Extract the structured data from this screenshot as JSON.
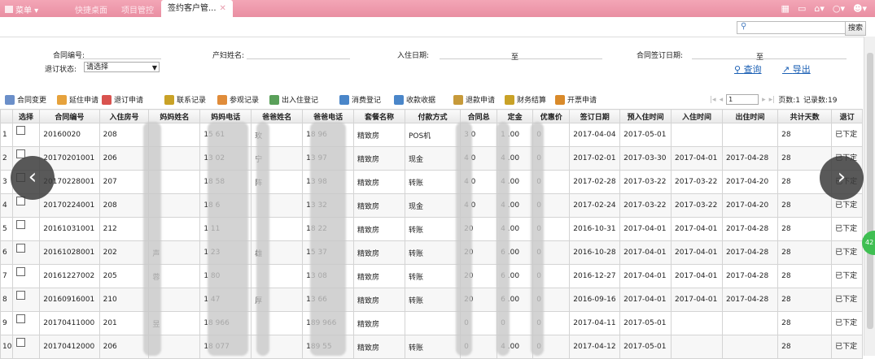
{
  "topbar": {
    "menu_label": "菜单 ▾",
    "tabs": [
      "快捷桌面",
      "项目管控"
    ],
    "active_tab": "签约客户管...",
    "active_close": "✕",
    "icons": [
      "grid-icon",
      "monitor-icon",
      "home-icon",
      "bulb-icon",
      "user-icon"
    ]
  },
  "search": {
    "placeholder": "",
    "button_label": "搜索"
  },
  "filters": {
    "contract_no_label": "合同编号:",
    "status_label": "退订状态:",
    "status_value": "请选择",
    "mother_name_label": "产妇姓名:",
    "checkin_date_label": "入住日期:",
    "to_label": "至",
    "sign_date_label": "合同签订日期:",
    "to_label2": "至",
    "query_label": "查询",
    "export_label": "导出"
  },
  "toolbar": {
    "items": [
      "合同变更",
      "延住申请",
      "退订申请",
      "联系记录",
      "参观记录",
      "出入住登记",
      "消费登记",
      "收款收据",
      "退款申请",
      "财务结算",
      "开票申请"
    ],
    "colors": [
      "#6b8fc9",
      "#e6a23c",
      "#d9534f",
      "#c9a227",
      "#e08c3a",
      "#5aa05a",
      "#4a86c9",
      "#4a86c9",
      "#c79a3a",
      "#c9a227",
      "#d98a2a"
    ]
  },
  "pager": {
    "page": "1",
    "pages_label": "页数:1",
    "records_label": "记录数:19"
  },
  "table": {
    "headers": [
      "",
      "选择",
      "合同编号",
      "入住房号",
      "妈妈姓名",
      "妈妈电话",
      "爸爸姓名",
      "爸爸电话",
      "套餐名称",
      "付款方式",
      "合同总",
      "定金",
      "优惠价",
      "签订日期",
      "预入住时间",
      "入住时间",
      "出住时间",
      "共计天数",
      "退订"
    ],
    "rows": [
      [
        "1",
        "",
        "20160020",
        "208",
        "",
        "15   61",
        "玫",
        "18   96",
        "精致房",
        "POS机",
        "3  0",
        "1  .00",
        "0",
        "2017-04-04",
        "2017-05-01",
        "",
        "",
        "28",
        "已下定"
      ],
      [
        "2",
        "",
        "20170201001",
        "206",
        "",
        "13   02",
        "宁",
        "13   97",
        "精致房",
        "现金",
        "4  0",
        "4  .00",
        "0",
        "2017-02-01",
        "2017-03-30",
        "2017-04-01",
        "2017-04-28",
        "28",
        "已下定"
      ],
      [
        "3",
        "",
        "20170228001",
        "207",
        "",
        "18   58",
        "阵",
        "13   98",
        "精致房",
        "转账",
        "4  0",
        "4  .00",
        "0",
        "2017-02-28",
        "2017-03-22",
        "2017-03-22",
        "2017-04-20",
        "28",
        "已下定"
      ],
      [
        "4",
        "",
        "20170224001",
        "208",
        "",
        "18   6",
        "",
        "13   32",
        "精致房",
        "现金",
        "4  0",
        "4  .00",
        "0",
        "2017-02-24",
        "2017-03-22",
        "2017-03-22",
        "2017-04-20",
        "28",
        "已下定"
      ],
      [
        "5",
        "",
        "20161031001",
        "212",
        "",
        "1   11",
        "",
        "18   22",
        "精致房",
        "转账",
        "  20",
        "4  .00",
        "0",
        "2016-10-31",
        "2017-04-01",
        "2017-04-01",
        "2017-04-28",
        "28",
        "已下定"
      ],
      [
        "6",
        "",
        "20161028001",
        "202",
        "声",
        "1   23",
        "雄",
        "15   37",
        "精致房",
        "转账",
        "  20",
        "6  .00",
        "0",
        "2016-10-28",
        "2017-04-01",
        "2017-04-01",
        "2017-04-28",
        "28",
        "已下定"
      ],
      [
        "7",
        "",
        "20161227002",
        "205",
        "蓉",
        "1   80",
        "",
        "13   08",
        "精致房",
        "转账",
        "  20",
        "6  .00",
        "0",
        "2016-12-27",
        "2017-04-01",
        "2017-04-01",
        "2017-04-28",
        "28",
        "已下定"
      ],
      [
        "8",
        "",
        "20160916001",
        "210",
        "",
        "1   47",
        "厚",
        "13   66",
        "精致房",
        "转账",
        "  20",
        "6  .00",
        "0",
        "2016-09-16",
        "2017-04-01",
        "2017-04-01",
        "2017-04-28",
        "28",
        "已下定"
      ],
      [
        "9",
        "",
        "20170411000",
        "201",
        "昱",
        "18   966",
        "",
        "189   966",
        "精致房",
        "",
        "  0",
        "0",
        "0",
        "2017-04-11",
        "2017-05-01",
        "",
        "",
        "28",
        "已下定"
      ],
      [
        "10",
        "",
        "20170412000",
        "206",
        "",
        "18   077",
        "",
        "189   55",
        "精致房",
        "转账",
        "  0",
        "4  .00",
        "0",
        "2017-04-12",
        "2017-05-01",
        "",
        "",
        "28",
        "已下定"
      ]
    ]
  },
  "side_badge": "42",
  "nav": {
    "prev": "‹",
    "next": "›"
  }
}
